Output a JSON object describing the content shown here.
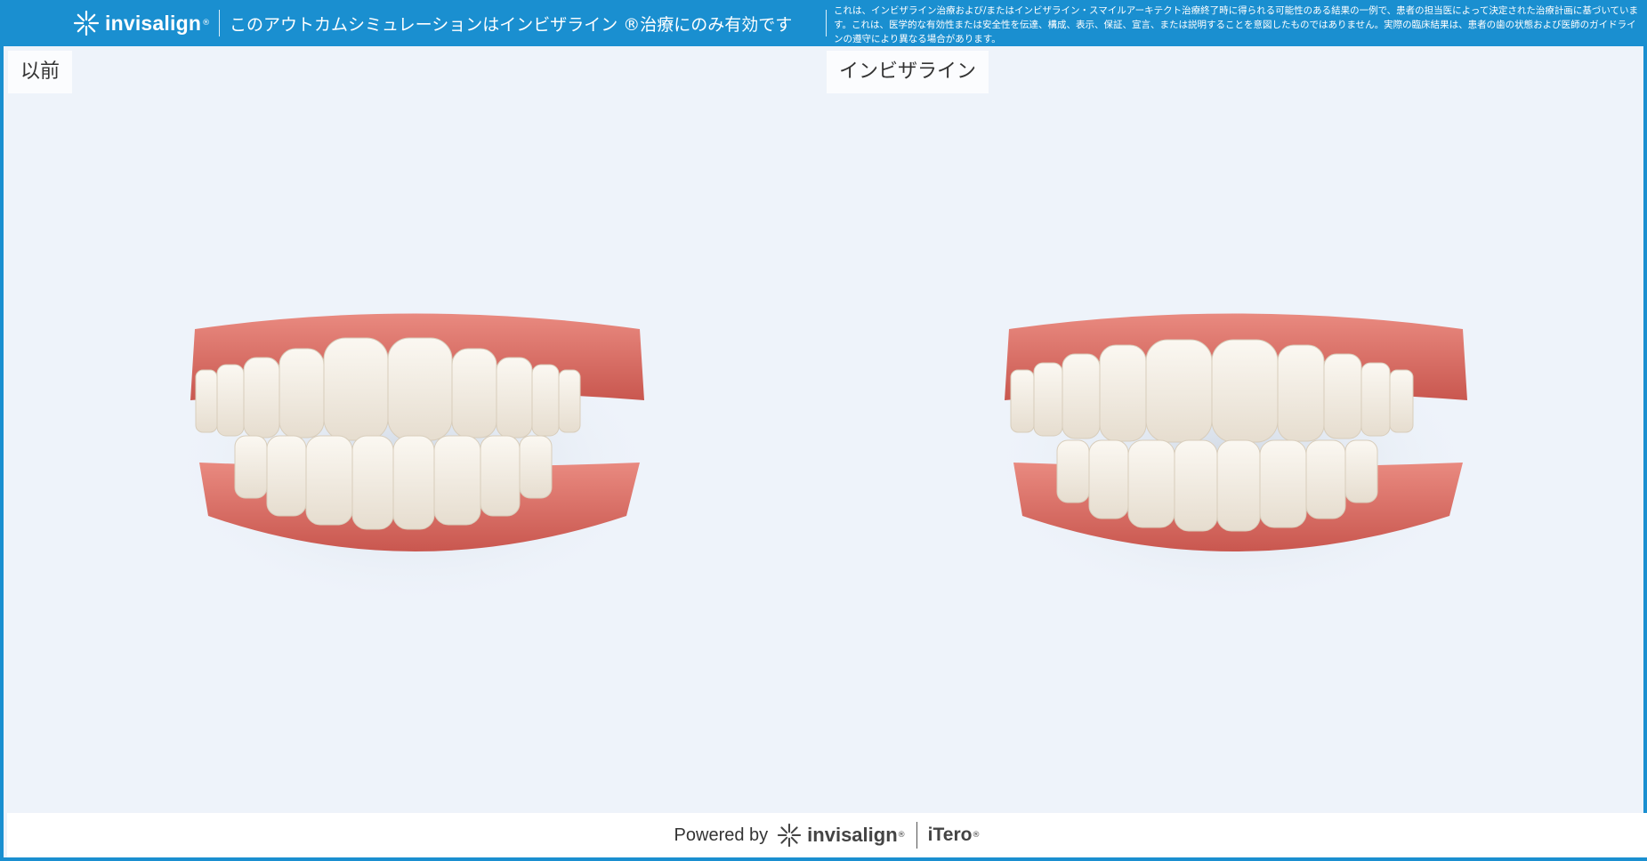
{
  "header": {
    "logo_text": "invisalign",
    "logo_reg": "®",
    "title": "このアウトカムシミュレーションはインビザライン ®治療にのみ有効です",
    "disclaimer": "これは、インビザライン治療および/またはインビザライン・スマイルアーキテクト治療終了時に得られる可能性のある結果の一例で、患者の担当医によって決定された治療計画に基づいています。これは、医学的な有効性または安全性を伝達、構成、表示、保証、宣言、または説明することを意図したものではありません。実際の臨床結果は、患者の歯の状態および医師のガイドラインの遵守により異なる場合があります。"
  },
  "views": {
    "before_label": "以前",
    "after_label": "インビザライン"
  },
  "footer": {
    "powered_by": "Powered by",
    "brand": "invisalign",
    "brand_reg": "®",
    "partner": "iTero",
    "partner_reg": "®"
  },
  "colors": {
    "header_bg": "#1a8fd0",
    "canvas_bg": "#eef3fa",
    "gum": "#e07a72",
    "tooth": "#f3eee6"
  },
  "icons": {
    "logo": "starburst-icon"
  }
}
